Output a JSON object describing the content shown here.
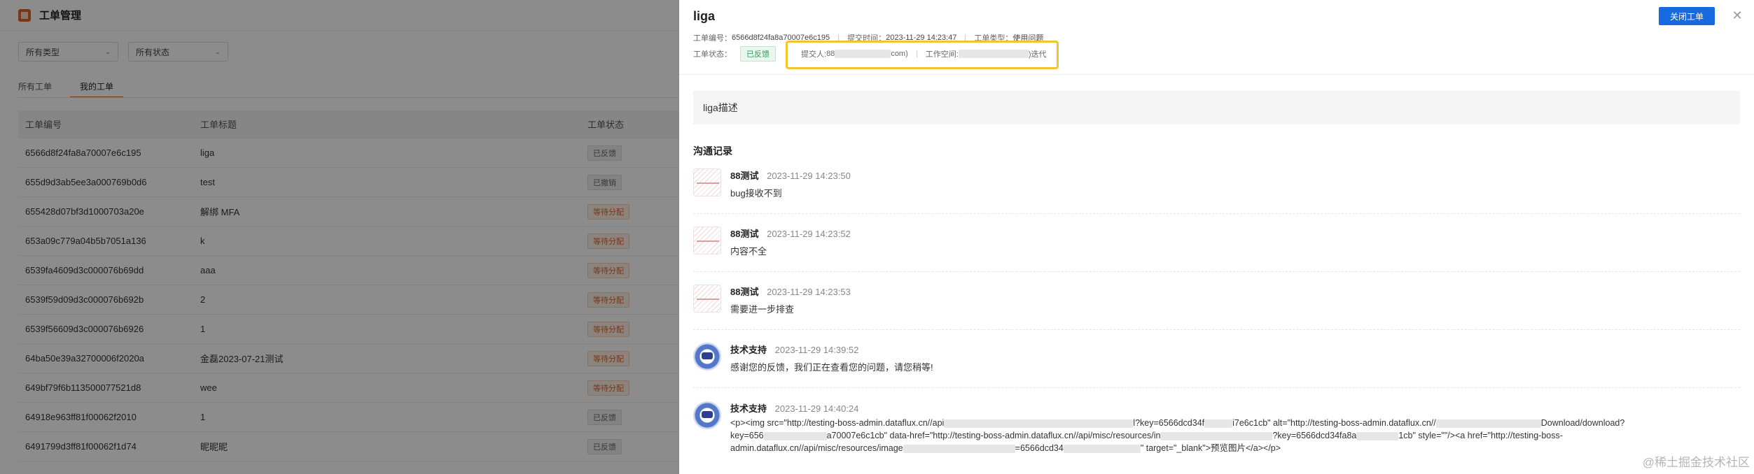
{
  "left": {
    "app_title": "工单管理",
    "filter_type": "所有类型",
    "filter_status": "所有状态",
    "tabs": [
      "所有工单",
      "我的工单"
    ],
    "columns": [
      "工单编号",
      "工单标题",
      "工单状态"
    ],
    "rows": [
      {
        "id": "6566d8f24fa8a70007e6c195",
        "title": "liga",
        "status": "已反馈"
      },
      {
        "id": "655d9d3ab5ee3a000769b0d6",
        "title": "test",
        "status": "已撤销"
      },
      {
        "id": "655428d07bf3d1000703a20e",
        "title": "解绑 MFA",
        "status": "等待分配"
      },
      {
        "id": "653a09c779a04b5b7051a136",
        "title": "k",
        "status": "等待分配"
      },
      {
        "id": "6539fa4609d3c000076b69dd",
        "title": "aaa",
        "status": "等待分配"
      },
      {
        "id": "6539f59d09d3c000076b692b",
        "title": "2",
        "status": "等待分配"
      },
      {
        "id": "6539f56609d3c000076b6926",
        "title": "1",
        "status": "等待分配"
      },
      {
        "id": "64ba50e39a32700006f2020a",
        "title": "金磊2023-07-21测试",
        "status": "等待分配"
      },
      {
        "id": "649bf79f6b113500077521d8",
        "title": "wee",
        "status": "等待分配"
      },
      {
        "id": "64918e963ff81f00062f2010",
        "title": "1",
        "status": "已反馈"
      },
      {
        "id": "6491799d3ff81f00062f1d74",
        "title": "昵昵昵",
        "status": "已反馈"
      }
    ]
  },
  "drawer": {
    "title": "liga",
    "close_button": "关闭工单",
    "ticket_no_label": "工单编号：",
    "ticket_no": "6566d8f24fa8a70007e6c195",
    "submit_time_label": "提交时间：",
    "submit_time": "2023-11-29 14:23:47",
    "ticket_type_label": "工单类型：",
    "ticket_type": "使用问题",
    "status_label": "工单状态：",
    "status_value": "已反馈",
    "submitter_label": "提交人: ",
    "submitter_prefix": "88",
    "submitter_suffix": "com)",
    "workspace_label": "工作空间: ",
    "workspace_suffix": ")迭代",
    "description": "liga描述",
    "section_title": "沟通记录",
    "messages": [
      {
        "name": "88测试",
        "time": "2023-11-29 14:23:50",
        "text": "bug接收不到"
      },
      {
        "name": "88测试",
        "time": "2023-11-29 14:23:52",
        "text": "内容不全"
      },
      {
        "name": "88测试",
        "time": "2023-11-29 14:23:53",
        "text": "需要进一步排查"
      },
      {
        "name": "技术支持",
        "time": "2023-11-29 14:39:52",
        "text": "感谢您的反馈，我们正在查看您的问题，请您稍等!"
      },
      {
        "name": "技术支持",
        "time": "2023-11-29 14:40:24",
        "text_a": "<p><img src=\"http://testing-boss-admin.dataflux.cn//api",
        "text_b": "l?key=6566dcd34f",
        "text_c": "i7e6c1cb\" alt=\"http://testing-boss-admin.dataflux.cn//",
        "text_d": "Download/download?",
        "text_e": "key=656",
        "text_f": "a70007e6c1cb\" data-href=\"http://testing-boss-admin.dataflux.cn//api/misc/resources/in",
        "text_g": "?key=6566dcd34fa8a",
        "text_h": "1cb\" style=\"\"/><a href=\"http://testing-boss-",
        "text_i": "admin.dataflux.cn//api/misc/resources/image",
        "text_j": "=6566dcd34",
        "text_k": "\" target=\"_blank\">预览图片</a></p>"
      }
    ]
  },
  "watermark": "@稀土掘金技术社区"
}
